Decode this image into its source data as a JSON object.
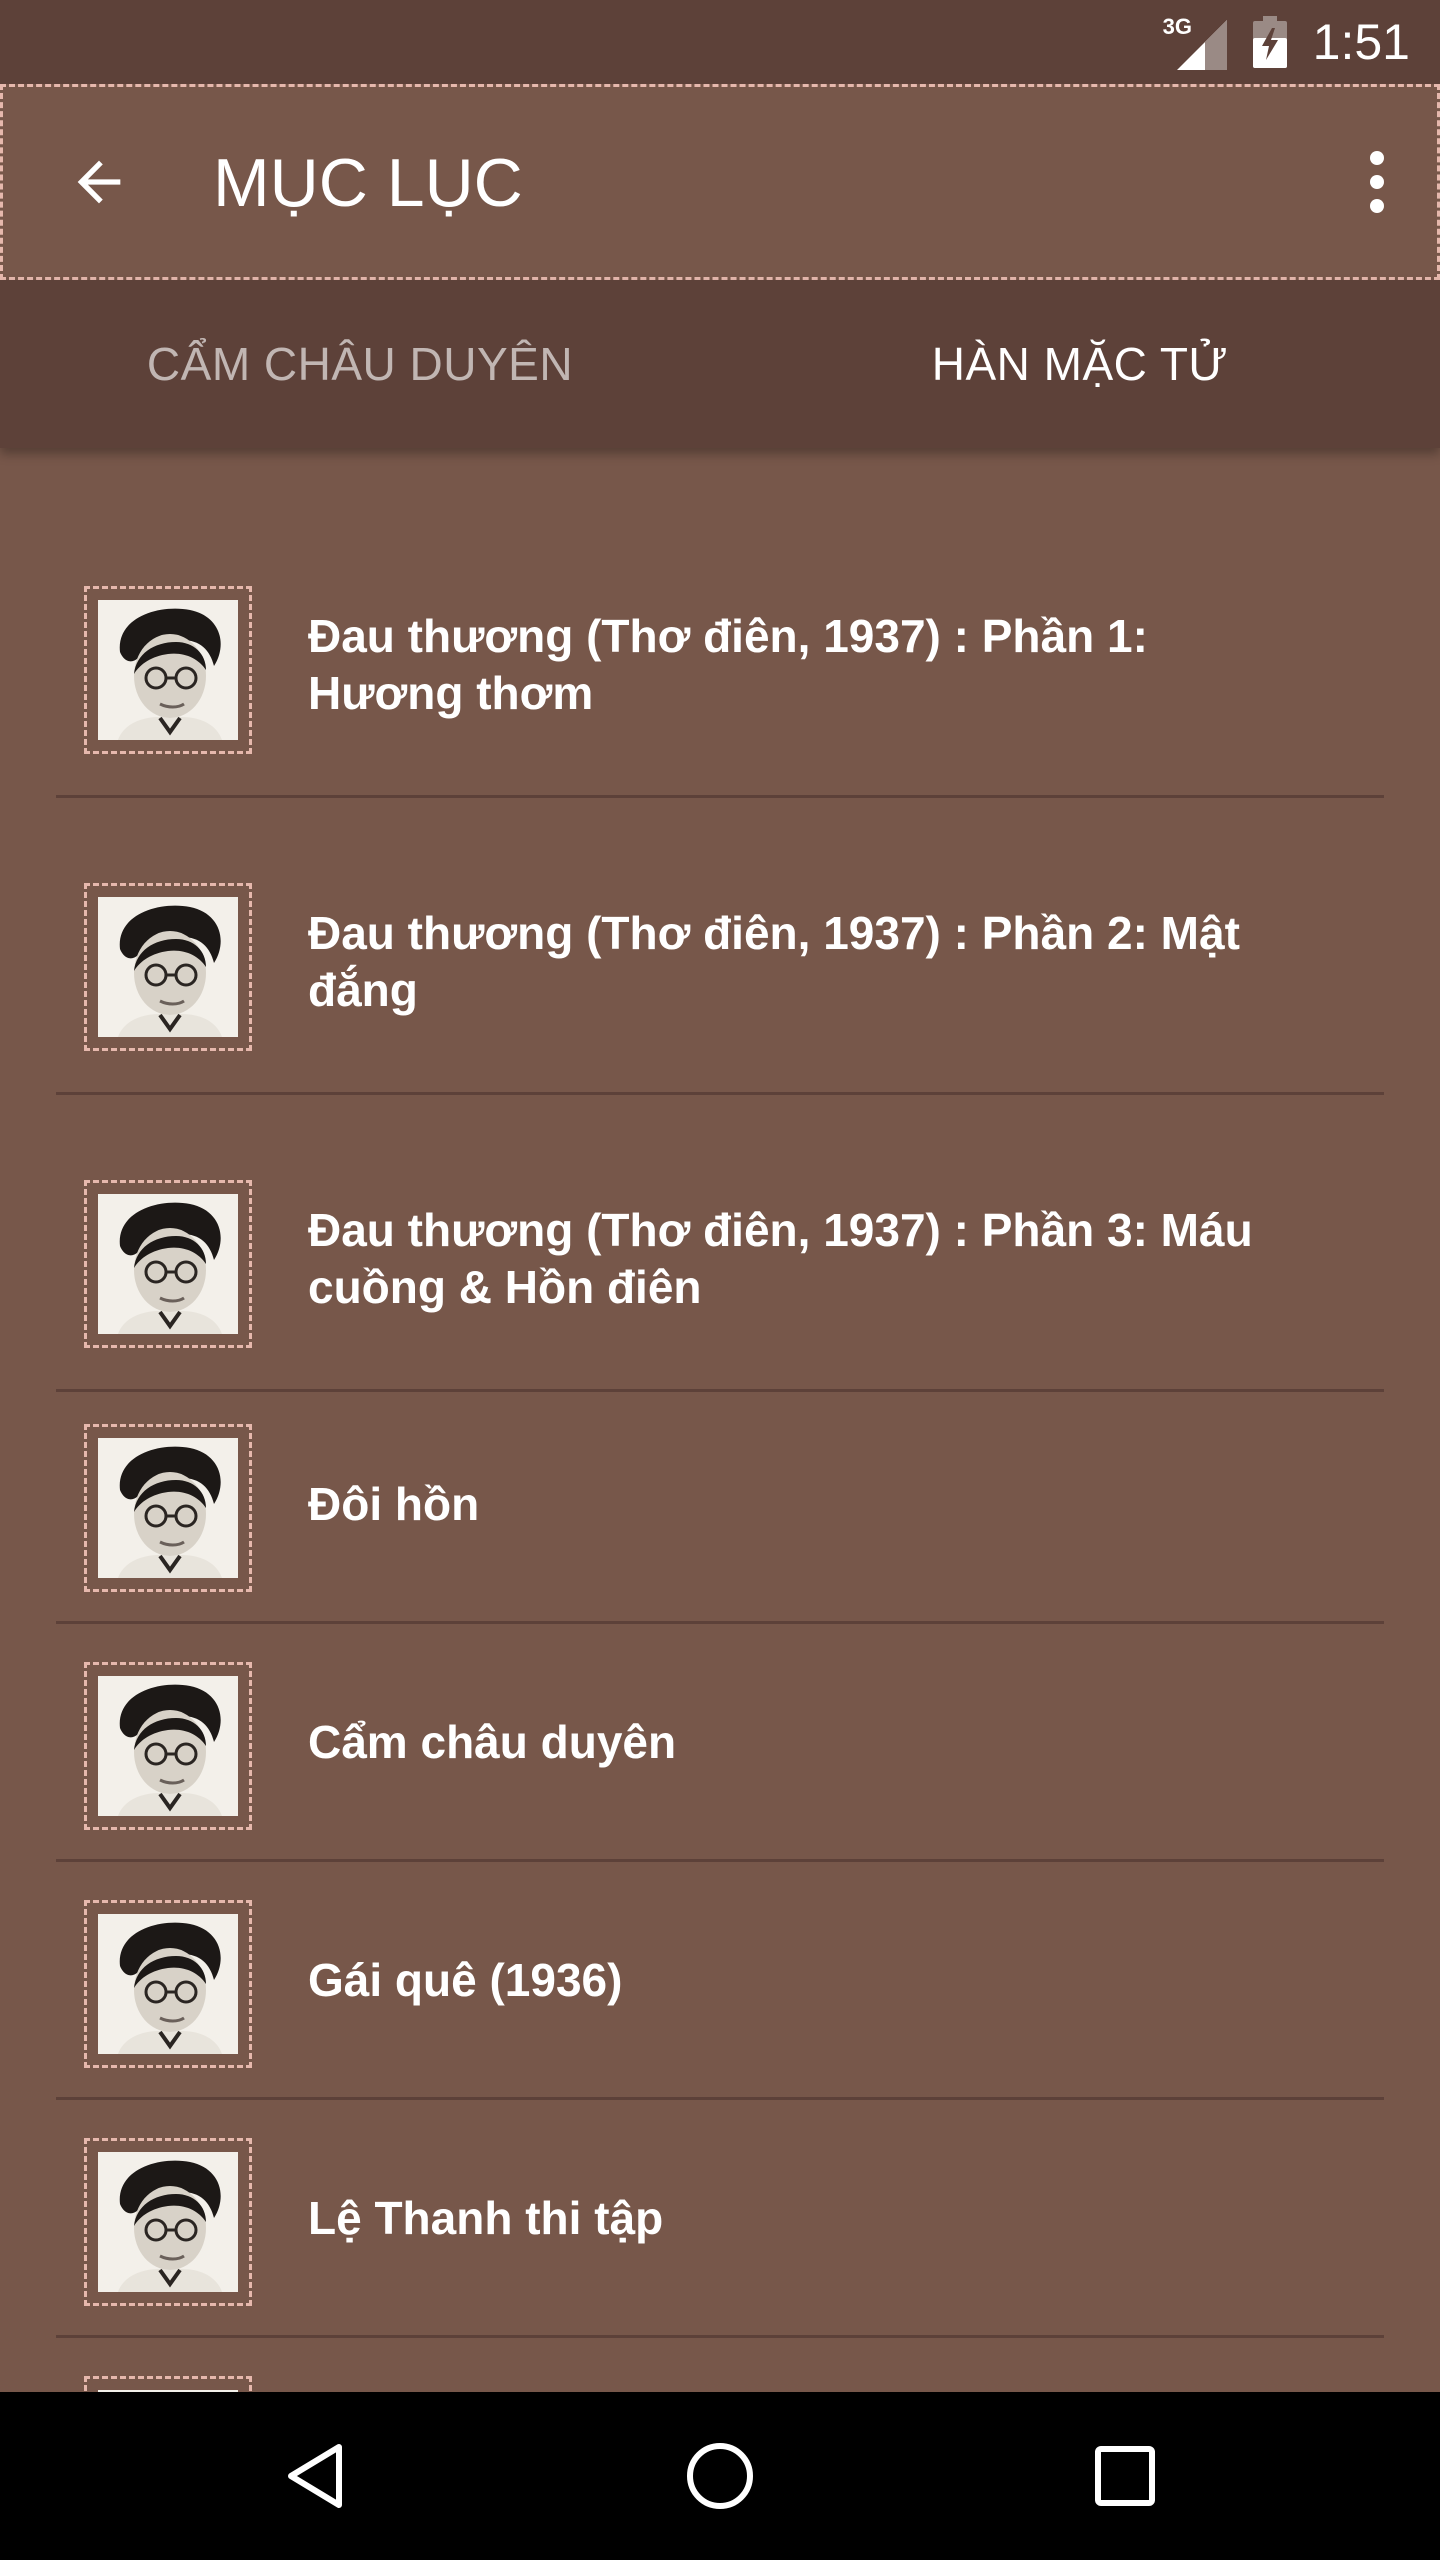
{
  "status_bar": {
    "network": "3G",
    "time": "1:51"
  },
  "app_bar": {
    "title": "MỤC LỤC"
  },
  "tabs": [
    {
      "label": "CẨM CHÂU DUYÊN",
      "selected": false
    },
    {
      "label": "HÀN MẶC TỬ",
      "selected": true
    }
  ],
  "list": {
    "items": [
      {
        "title_line1": "Đau thương (Thơ điên, 1937) : Phần 1:",
        "title_line2": "Hương thơm"
      },
      {
        "title_line1": "Đau thương (Thơ điên, 1937) : Phần 2: Mật",
        "title_line2": "đắng"
      },
      {
        "title_line1": "Đau thương (Thơ điên, 1937) : Phần 3: Máu",
        "title_line2": "cuồng & Hồn điên"
      },
      {
        "title_line1": "Đôi hồn",
        "title_line2": ""
      },
      {
        "title_line1": "Cẩm châu duyên",
        "title_line2": ""
      },
      {
        "title_line1": "Gái quê (1936)",
        "title_line2": ""
      },
      {
        "title_line1": "Lệ Thanh thi tập",
        "title_line2": ""
      },
      {
        "title_line1": "",
        "title_line2": ""
      }
    ]
  },
  "icons": {
    "back": "arrow-back-icon",
    "more": "more-vert-icon",
    "thumbnail": "author-portrait",
    "nav_back": "triangle-back-icon",
    "nav_home": "circle-home-icon",
    "nav_recents": "square-recents-icon"
  },
  "colors": {
    "primary": "#77574a",
    "primary_dark": "#5d4139",
    "accent_dash": "#e6b8ad"
  }
}
